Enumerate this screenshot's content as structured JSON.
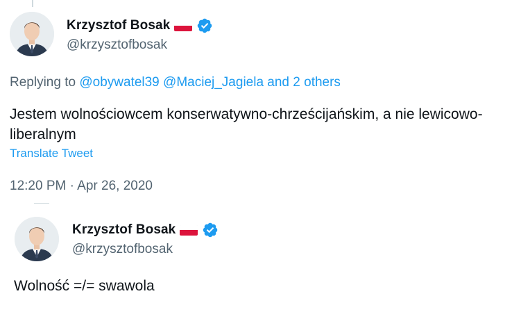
{
  "tweet1": {
    "author_name": "Krzysztof Bosak",
    "author_handle": "@krzysztofbosak",
    "replying_prefix": "Replying to ",
    "reply_mention1": "@obywatel39",
    "reply_mention2": "@Maciej_Jagiela",
    "reply_others": "and 2 others",
    "text": "Jestem wolnościowcem konserwatywno-chrześcijańskim, a nie lewicowo-liberalnym",
    "translate_label": "Translate Tweet",
    "timestamp": "12:20 PM · Apr 26, 2020"
  },
  "tweet2": {
    "author_name": "Krzysztof Bosak",
    "author_handle": "@krzysztofbosak",
    "text": "Wolność =/= swawola"
  },
  "colors": {
    "link": "#1d9bf0",
    "secondary_text": "#536471",
    "verified": "#1d9bf0",
    "flag_red": "#dc143c"
  },
  "icons": {
    "verified": "verified-badge-icon",
    "flag": "poland-flag-icon"
  }
}
